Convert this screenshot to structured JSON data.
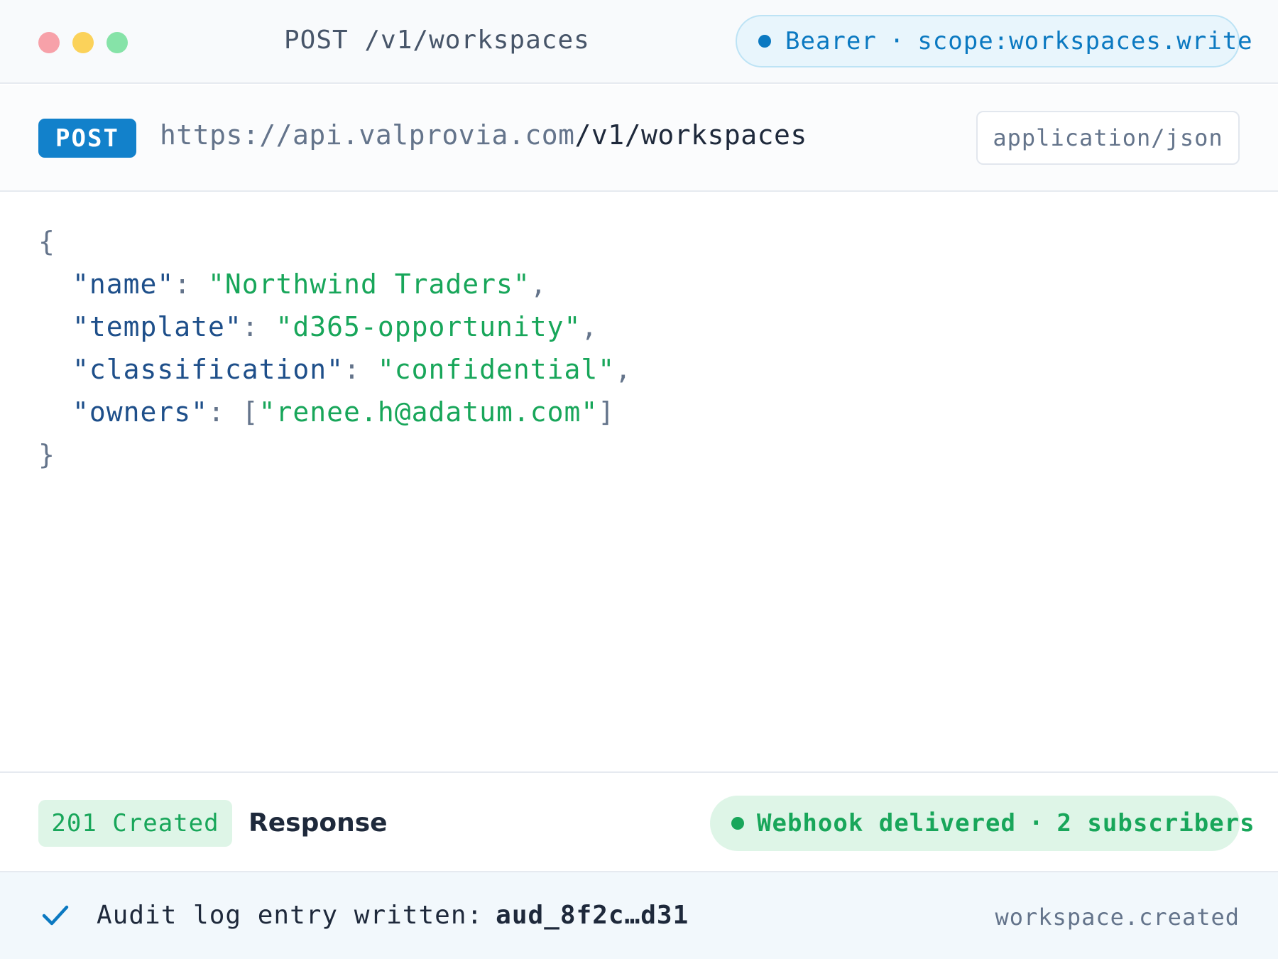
{
  "window": {
    "title": "POST /v1/workspaces",
    "auth_token_type": "Bearer",
    "auth_separator": "·",
    "auth_scope": "scope:workspaces.write"
  },
  "request": {
    "method": "POST",
    "url_host": "https://api.valprovia.com",
    "url_path": "/v1/workspaces",
    "content_type": "application/json"
  },
  "body": {
    "open_brace": "{",
    "close_brace": "}",
    "fields": [
      {
        "key": "\"name\"",
        "colon": ": ",
        "value": "\"Northwind Traders\"",
        "trail": ","
      },
      {
        "key": "\"template\"",
        "colon": ": ",
        "value": "\"d365-opportunity\"",
        "trail": ","
      },
      {
        "key": "\"classification\"",
        "colon": ": ",
        "value": "\"confidential\"",
        "trail": ","
      },
      {
        "key": "\"owners\"",
        "colon": ": [",
        "value": "\"renee.h@adatum.com\"",
        "trail": "]"
      }
    ]
  },
  "response": {
    "status": "201 Created",
    "label": "Response",
    "webhook_status": "Webhook delivered",
    "webhook_separator": "·",
    "webhook_subscribers": "2 subscribers"
  },
  "audit": {
    "message": "Audit log entry written:",
    "entry_id": "aud_8f2c…d31",
    "event": "workspace.created",
    "icon": "check-icon"
  },
  "colors": {
    "method_badge": "#1281cb",
    "success": "#18a65a",
    "auth_accent": "#0b79c1",
    "json_key": "#1e4f8a"
  }
}
